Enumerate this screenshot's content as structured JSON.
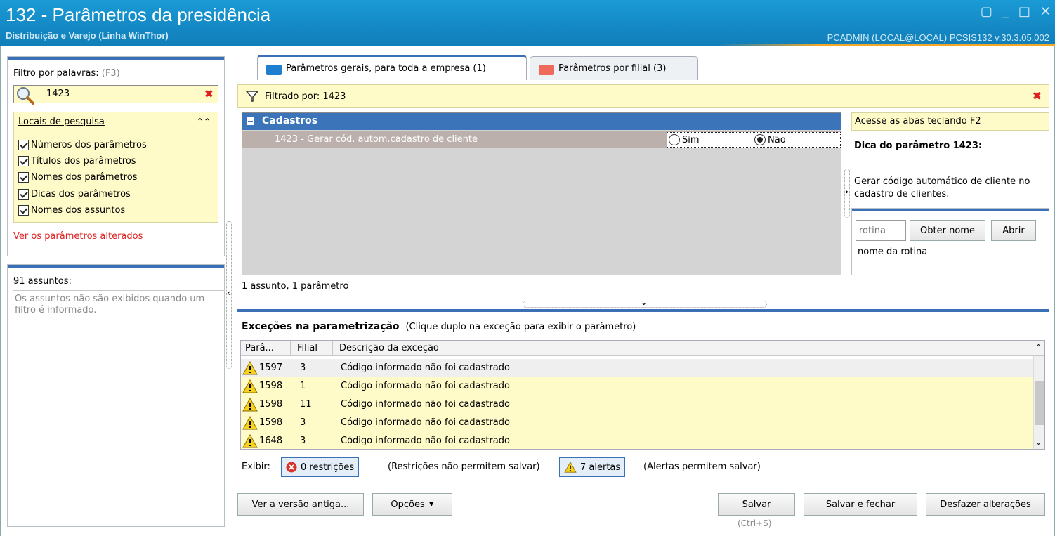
{
  "window": {
    "title": "132 - Parâmetros da presidência",
    "subtitle": "Distribuição e Varejo (Linha WinThor)",
    "user_info": "PCADMIN (LOCAL@LOCAL)  PCSIS132  v.30.3.05.002"
  },
  "filter": {
    "label": "Filtro por palavras:",
    "shortcut": "(F3)",
    "value": "1423",
    "locais_title": "Locais de pesquisa",
    "options": [
      "Números dos parâmetros",
      "Títulos dos parâmetros",
      "Nomes dos parâmetros",
      "Dicas dos parâmetros",
      "Nomes dos assuntos"
    ],
    "link": "Ver os parâmetros alterados"
  },
  "assuntos": {
    "count_label": "91 assuntos:",
    "message": "Os assuntos não são exibidos quando um filtro é informado."
  },
  "tabs": [
    {
      "label": "Parâmetros gerais, para toda a empresa  (1)",
      "color": "#1e7fd0"
    },
    {
      "label": "Parâmetros por filial  (3)",
      "color": "#f06a5c"
    }
  ],
  "filtered_by": "Filtrado por: 1423",
  "grid": {
    "group": "Cadastros",
    "row_label": "1423 - Gerar cód. autom.cadastro de cliente",
    "options": [
      "Sim",
      "Não"
    ],
    "selected": "Não",
    "status": "1 assunto, 1 parâmetro"
  },
  "dica": {
    "access_hint": "Acesse as abas teclando F2",
    "title": "Dica do parâmetro 1423:",
    "text": "Gerar código automático de cliente no cadastro de clientes.",
    "rotina_placeholder": "rotina",
    "btn_obter": "Obter nome",
    "btn_abrir": "Abrir",
    "rotina_name": "nome da rotina"
  },
  "exceptions": {
    "title": "Exceções na parametrização",
    "hint": "(Clique duplo na exceção para exibir o parâmetro)",
    "columns": [
      "Parâ...",
      "Filial",
      "Descrição da exceção"
    ],
    "rows": [
      {
        "param": "1597",
        "filial": "3",
        "desc": "Código informado não foi cadastrado"
      },
      {
        "param": "1598",
        "filial": "1",
        "desc": "Código informado não foi cadastrado"
      },
      {
        "param": "1598",
        "filial": "11",
        "desc": "Código informado não foi cadastrado"
      },
      {
        "param": "1598",
        "filial": "3",
        "desc": "Código informado não foi cadastrado"
      },
      {
        "param": "1648",
        "filial": "3",
        "desc": "Código informado não foi cadastrado"
      }
    ],
    "exibir_label": "Exibir:",
    "restricoes": "0 restrições",
    "restricoes_hint": "(Restrições não permitem salvar)",
    "alertas": "7 alertas",
    "alertas_hint": "(Alertas permitem salvar)"
  },
  "buttons": {
    "versao_antiga": "Ver a versão antiga...",
    "opcoes": "Opções",
    "salvar": "Salvar",
    "salvar_shortcut": "(Ctrl+S)",
    "salvar_fechar": "Salvar e fechar",
    "desfazer": "Desfazer alterações"
  }
}
